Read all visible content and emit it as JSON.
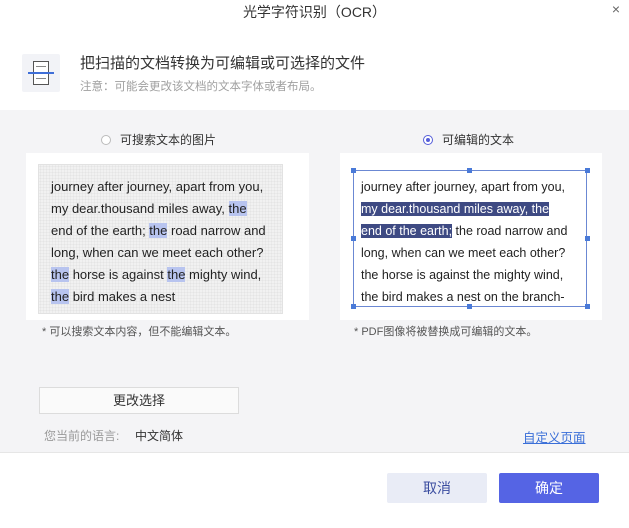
{
  "window": {
    "title": "光学字符识别（OCR）",
    "close_icon": "×"
  },
  "header": {
    "title": "把扫描的文档转换为可编辑或可选择的文件",
    "note": "注意：可能会更改该文档的文本字体或者布局。"
  },
  "options": {
    "searchable_image": {
      "label": "可搜索文本的图片",
      "selected": false
    },
    "editable_text": {
      "label": "可编辑的文本",
      "selected": true
    }
  },
  "image_preview": {
    "segments": [
      {
        "t": "journey after journey, apart from you, my dear.thousand miles away, ",
        "h": false
      },
      {
        "t": "the",
        "h": true
      },
      {
        "t": " end of the earth; ",
        "h": false
      },
      {
        "t": "the",
        "h": true
      },
      {
        "t": " road narrow and long, when can we meet each other? ",
        "h": false
      },
      {
        "t": "the",
        "h": true
      },
      {
        "t": " horse is against ",
        "h": false
      },
      {
        "t": "the",
        "h": true
      },
      {
        "t": " mighty wind, ",
        "h": false
      },
      {
        "t": "the",
        "h": true
      },
      {
        "t": " bird makes a nest",
        "h": false
      }
    ],
    "caption": "* 可以搜索文本内容，但不能编辑文本。"
  },
  "text_preview": {
    "line1": "journey after journey, apart from you,",
    "sel1": "my dear.thousand miles away, the",
    "sel2": "end of the earth;",
    "rest2": " the road narrow and",
    "line4": "long, when can we meet each other?",
    "line5": "the horse is against the mighty wind,",
    "line6": "the bird makes a nest on the branch-",
    "caption": "* PDF图像将被替换成可编辑的文本。"
  },
  "change_button": "更改选择",
  "language": {
    "label": "您当前的语言:",
    "value": "中文简体"
  },
  "custom_page_link": "自定义页面",
  "buttons": {
    "cancel": "取消",
    "ok": "确定"
  }
}
